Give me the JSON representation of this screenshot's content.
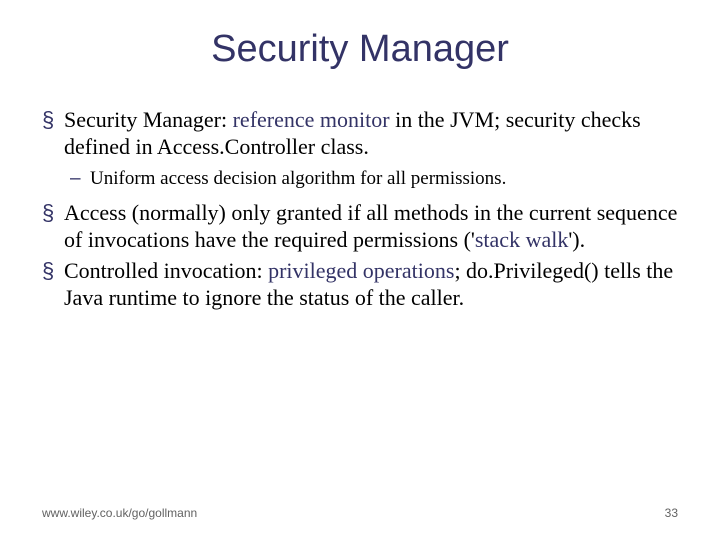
{
  "title": "Security Manager",
  "bullets": [
    {
      "pre1": "Security Manager: ",
      "hl1": "reference monitor",
      "post1": " in the JVM; security checks defined in Access.Controller class.",
      "sub": [
        {
          "text": "Uniform access decision algorithm for all permissions."
        }
      ]
    },
    {
      "pre1": "Access (normally) only granted if all methods in the current sequence of invocations have the required permissions ('",
      "hl1": "stack walk",
      "post1": "')."
    },
    {
      "pre1": "Controlled invocation: ",
      "hl1": "privileged operations",
      "post1": "; do.Privileged() tells the Java runtime to ignore the status of the caller."
    }
  ],
  "footer": {
    "url": "www.wiley.co.uk/go/gollmann",
    "page": "33"
  }
}
